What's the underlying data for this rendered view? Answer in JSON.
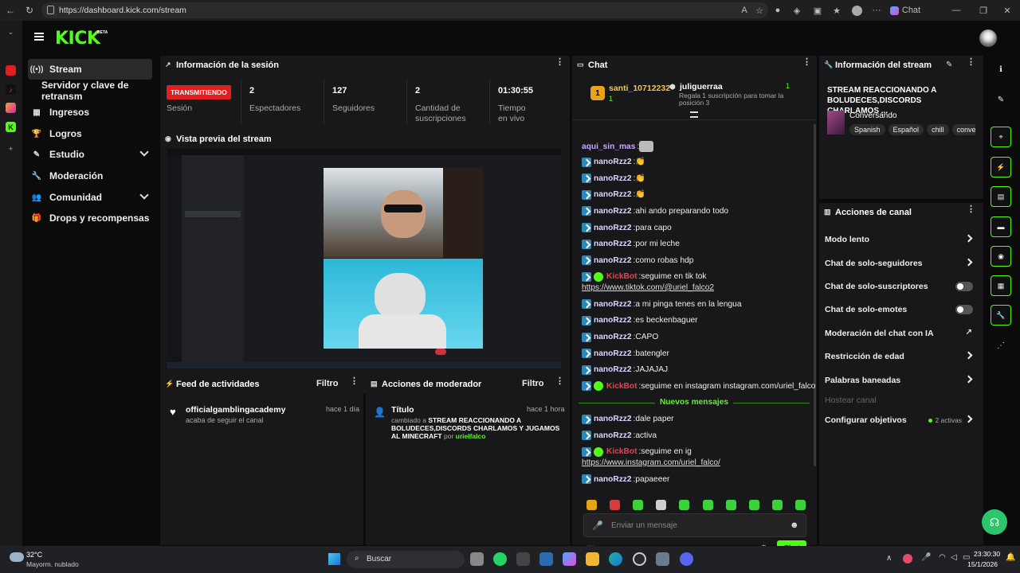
{
  "browser": {
    "url": "https://dashboard.kick.com/stream",
    "copilot_label": "Chat"
  },
  "logo": {
    "text": "KICK",
    "badge": "BETA"
  },
  "sidebar": {
    "items": [
      {
        "label": "Stream",
        "icon": "broadcast-icon",
        "active": true
      },
      {
        "label": "Servidor y clave de retransm",
        "icon": "",
        "sub": true
      },
      {
        "label": "Ingresos",
        "icon": "chart-icon"
      },
      {
        "label": "Logros",
        "icon": "trophy-icon"
      },
      {
        "label": "Estudio",
        "icon": "brush-icon",
        "expand": true
      },
      {
        "label": "Moderación",
        "icon": "wrench-icon"
      },
      {
        "label": "Comunidad",
        "icon": "people-icon",
        "expand": true
      },
      {
        "label": "Drops y recompensas",
        "icon": "gift-icon"
      }
    ]
  },
  "session": {
    "title": "Información de la sesión",
    "status": "TRANSMITIENDO",
    "status_label": "Sesión",
    "stats": [
      {
        "value": "2",
        "label": "Espectadores"
      },
      {
        "value": "127",
        "label": "Seguidores"
      },
      {
        "value": "2",
        "label": "Cantidad de suscripciones"
      },
      {
        "value": "01:30:55",
        "label": "Tiempo en vivo"
      }
    ]
  },
  "preview": {
    "title": "Vista previa del stream"
  },
  "activity": {
    "title": "Feed de actividades",
    "filter": "Filtro",
    "items": [
      {
        "user": "officialgamblingacademy",
        "text": "acaba de seguir el canal",
        "time": "hace 1 día"
      }
    ]
  },
  "modactions": {
    "title": "Acciones de moderador",
    "filter": "Filtro",
    "items": [
      {
        "heading": "Título",
        "time": "hace 1 hora",
        "prefix": "cambiado a",
        "value": "STREAM REACCIONANDO A BOLUDECES,DISCORDS CHARLAMOS Y JUGAMOS AL MINECRAFT",
        "by": "por",
        "user": "urielfalco"
      }
    ]
  },
  "chat": {
    "title": "Chat",
    "leader": {
      "rank": "1",
      "name": "santi_10712232",
      "count": "1"
    },
    "gift": {
      "name": "juliguerraa",
      "count": "1",
      "text": "Regala 1 suscripción para tomar la posición 3"
    },
    "messages": [
      {
        "user": "aqui_sin_mas",
        "text": "",
        "type": "plain"
      },
      {
        "user": "nanoRzz2",
        "text": "👏",
        "type": "badge"
      },
      {
        "user": "nanoRzz2",
        "text": "👏",
        "type": "badge"
      },
      {
        "user": "nanoRzz2",
        "text": "👏",
        "type": "badge"
      },
      {
        "user": "nanoRzz2",
        "text": "ahi ando preparando todo",
        "type": "badge"
      },
      {
        "user": "nanoRzz2",
        "text": "para capo",
        "type": "badge"
      },
      {
        "user": "nanoRzz2",
        "text": "por mi leche",
        "type": "badge"
      },
      {
        "user": "nanoRzz2",
        "text": "como robas hdp",
        "type": "badge"
      },
      {
        "user": "KickBot",
        "text": "seguime en tik tok",
        "type": "bot"
      },
      {
        "user": "",
        "text": "https://www.tiktok.com/@uriel_falco2",
        "type": "link"
      },
      {
        "user": "nanoRzz2",
        "text": "a mi pinga tenes en la lengua",
        "type": "badge"
      },
      {
        "user": "nanoRzz2",
        "text": "es beckenbaguer",
        "type": "badge"
      },
      {
        "user": "nanoRzz2",
        "text": "CAPO",
        "type": "badge"
      },
      {
        "user": "nanoRzz2",
        "text": "batengler",
        "type": "badge"
      },
      {
        "user": "nanoRzz2",
        "text": "JAJAJAJ",
        "type": "badge"
      },
      {
        "user": "KickBot",
        "text": "seguime en instagram instagram.com/uriel_falco",
        "type": "bot"
      },
      {
        "user": "",
        "text": "Nuevos mensajes",
        "type": "divider"
      },
      {
        "user": "nanoRzz2",
        "text": "dale paper",
        "type": "badge"
      },
      {
        "user": "nanoRzz2",
        "text": "activa",
        "type": "badge"
      },
      {
        "user": "KickBot",
        "text": "seguime en ig",
        "type": "bot"
      },
      {
        "user": "",
        "text": "https://www.instagram.com/uriel_falco/",
        "type": "link"
      },
      {
        "user": "nanoRzz2",
        "text": "papaeeer",
        "type": "badge"
      }
    ],
    "input_placeholder": "Enviar un mensaje",
    "send_label": "Chat"
  },
  "stream_info": {
    "title": "Información del stream",
    "stream_title": "STREAM REACCIONANDO A BOLUDECES,DISCORDS CHARLAMOS ...",
    "category": "Conversando",
    "tags": [
      "Spanish",
      "Español",
      "chill",
      "conve"
    ]
  },
  "channel_actions": {
    "title": "Acciones de canal",
    "items": [
      {
        "label": "Modo lento",
        "control": "arrow"
      },
      {
        "label": "Chat de solo-seguidores",
        "control": "arrow"
      },
      {
        "label": "Chat de solo-suscriptores",
        "control": "toggle"
      },
      {
        "label": "Chat de solo-emotes",
        "control": "toggle"
      },
      {
        "label": "Moderación del chat con IA",
        "control": "external"
      },
      {
        "label": "Restricción de edad",
        "control": "arrow"
      },
      {
        "label": "Palabras baneadas",
        "control": "arrow"
      },
      {
        "label": "Hostear canal",
        "control": "disabled"
      },
      {
        "label": "Configurar objetivos",
        "control": "arrow",
        "extra": "2 activas"
      }
    ]
  },
  "taskbar": {
    "weather_temp": "32°C",
    "weather_text": "Mayorm. nublado",
    "search": "Buscar",
    "time": "23:30:30",
    "date": "15/1/2026"
  },
  "colors": {
    "accent": "#53fc18",
    "live": "#e02020",
    "panel": "#18181a",
    "bg": "#0b0b0c"
  }
}
